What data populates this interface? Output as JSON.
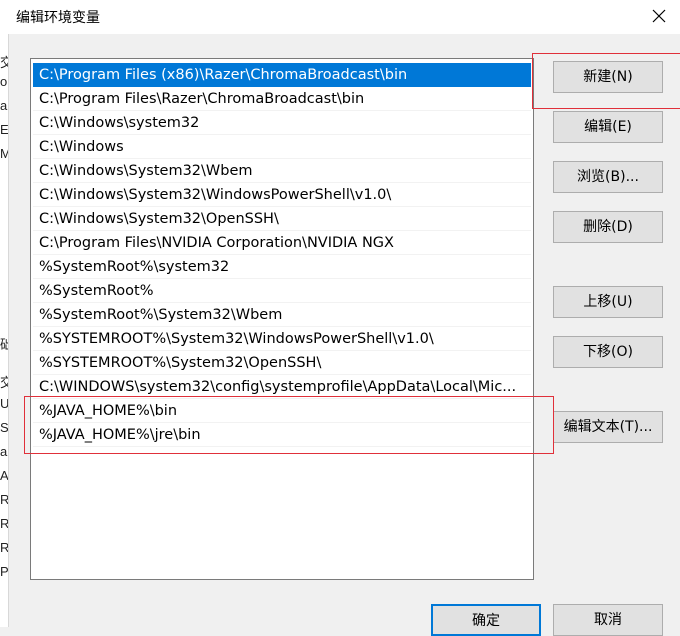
{
  "dialog": {
    "title": "编辑环境变量",
    "close_label": "×"
  },
  "background_fragments": [
    "交",
    "or",
    "a",
    "E",
    "M",
    "础",
    "交",
    "U",
    "S",
    "a",
    "A",
    "R",
    "R",
    "R",
    "P"
  ],
  "path_list": {
    "items": [
      "C:\\Program Files (x86)\\Razer\\ChromaBroadcast\\bin",
      "C:\\Program Files\\Razer\\ChromaBroadcast\\bin",
      "C:\\Windows\\system32",
      "C:\\Windows",
      "C:\\Windows\\System32\\Wbem",
      "C:\\Windows\\System32\\WindowsPowerShell\\v1.0\\",
      "C:\\Windows\\System32\\OpenSSH\\",
      "C:\\Program Files\\NVIDIA Corporation\\NVIDIA NGX",
      "%SystemRoot%\\system32",
      "%SystemRoot%",
      "%SystemRoot%\\System32\\Wbem",
      "%SYSTEMROOT%\\System32\\WindowsPowerShell\\v1.0\\",
      "%SYSTEMROOT%\\System32\\OpenSSH\\",
      "C:\\WINDOWS\\system32\\config\\systemprofile\\AppData\\Local\\Mic...",
      "%JAVA_HOME%\\bin",
      "%JAVA_HOME%\\jre\\bin"
    ]
  },
  "buttons": {
    "new": "新建(N)",
    "edit": "编辑(E)",
    "browse": "浏览(B)...",
    "delete": "删除(D)",
    "move_up": "上移(U)",
    "move_down": "下移(O)",
    "edit_text": "编辑文本(T)...",
    "ok": "确定",
    "cancel": "取消"
  },
  "colors": {
    "selection": "#0078d7",
    "highlight_box": "#e0303a"
  }
}
